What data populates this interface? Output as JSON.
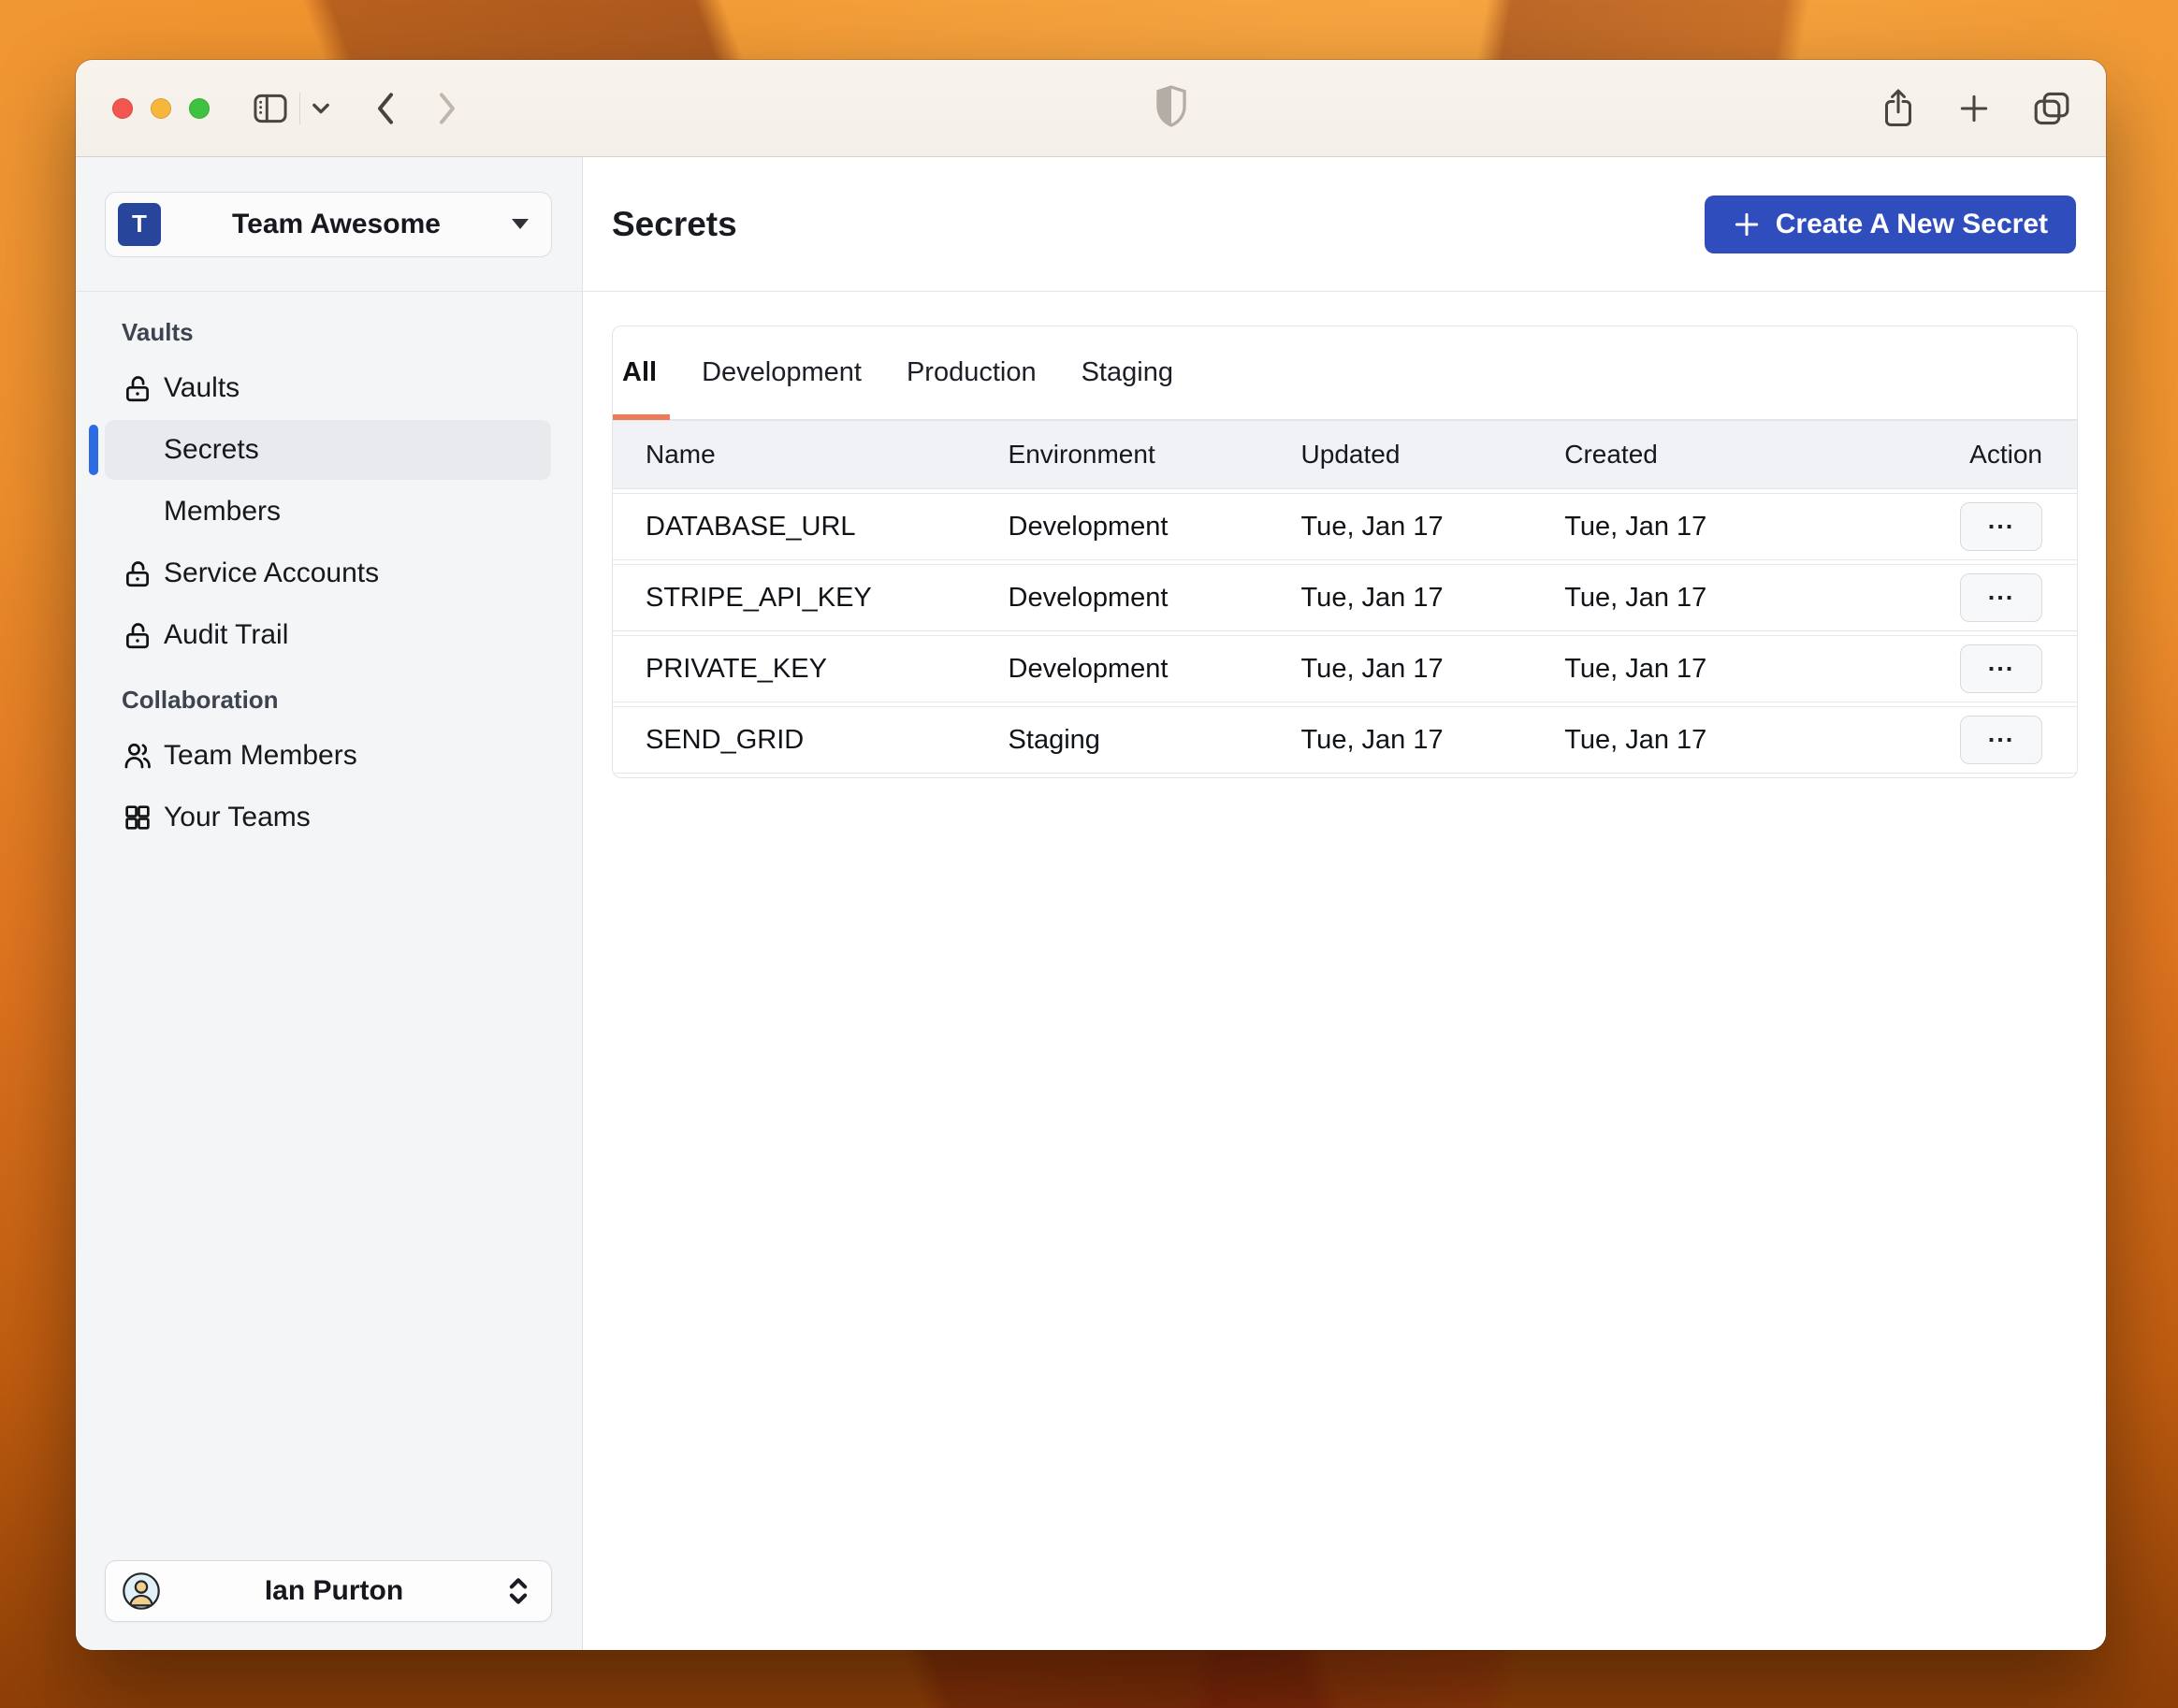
{
  "titlebar": {
    "buttons": [
      "close",
      "minimize",
      "fullscreen"
    ]
  },
  "sidebar": {
    "team": {
      "avatar_letter": "T",
      "name": "Team Awesome"
    },
    "sections": [
      {
        "label": "Vaults",
        "items": [
          {
            "label": "Vaults"
          },
          {
            "label": "Secrets",
            "selected": true
          },
          {
            "label": "Members"
          },
          {
            "label": "Service Accounts"
          },
          {
            "label": "Audit Trail"
          }
        ]
      },
      {
        "label": "Collaboration",
        "items": [
          {
            "label": "Team Members"
          },
          {
            "label": "Your Teams"
          }
        ]
      }
    ],
    "user": {
      "name": "Ian Purton"
    }
  },
  "main": {
    "title": "Secrets",
    "create_button_label": "Create A New Secret",
    "tabs": [
      {
        "label": "All",
        "active": true
      },
      {
        "label": "Development",
        "active": false
      },
      {
        "label": "Production",
        "active": false
      },
      {
        "label": "Staging",
        "active": false
      }
    ],
    "table": {
      "columns": [
        "Name",
        "Environment",
        "Updated",
        "Created",
        "Action"
      ],
      "action_label": "...",
      "rows": [
        {
          "name": "DATABASE_URL",
          "environment": "Development",
          "updated": "Tue, Jan 17",
          "created": "Tue, Jan 17"
        },
        {
          "name": "STRIPE_API_KEY",
          "environment": "Development",
          "updated": "Tue, Jan 17",
          "created": "Tue, Jan 17"
        },
        {
          "name": "PRIVATE_KEY",
          "environment": "Development",
          "updated": "Tue, Jan 17",
          "created": "Tue, Jan 17"
        },
        {
          "name": "SEND_GRID",
          "environment": "Staging",
          "updated": "Tue, Jan 17",
          "created": "Tue, Jan 17"
        }
      ]
    }
  },
  "colors": {
    "accent_blue": "#304dbe",
    "team_avatar_blue": "#27459a",
    "selected_indicator_blue": "#2d6be4",
    "active_tab_underline": "#ee7a58",
    "traffic_red": "#f2564f",
    "traffic_yellow": "#f5b63b",
    "traffic_green": "#3ec23f",
    "sidebar_bg": "#f4f5f7",
    "titlebar_bg": "#f6f1ea"
  }
}
